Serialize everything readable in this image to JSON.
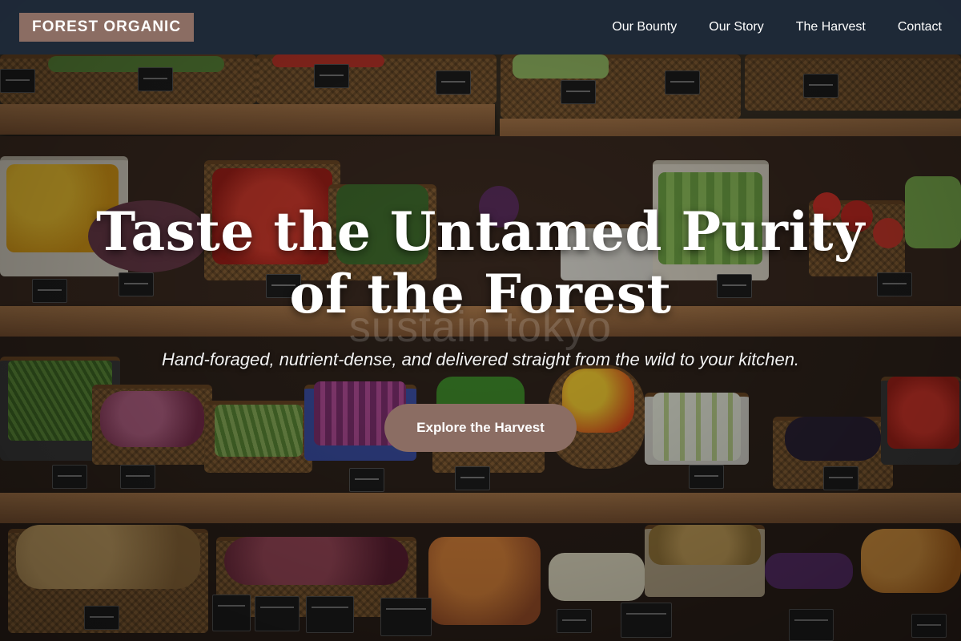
{
  "brand": {
    "logo_text": "FOREST ORGANIC"
  },
  "nav": {
    "items": [
      {
        "label": "Our Bounty"
      },
      {
        "label": "Our Story"
      },
      {
        "label": "The Harvest"
      },
      {
        "label": "Contact"
      }
    ]
  },
  "hero": {
    "title_line1": "Taste the Untamed Purity",
    "title_line2": "of the Forest",
    "subtitle": "Hand-foraged, nutrient-dense, and delivered straight from the wild to your kitchen.",
    "cta_label": "Explore the Harvest",
    "watermark": "sustain tokyo"
  },
  "colors": {
    "accent": "#8b6d63",
    "navbar": "#1e2a3a",
    "text": "#ffffff"
  }
}
